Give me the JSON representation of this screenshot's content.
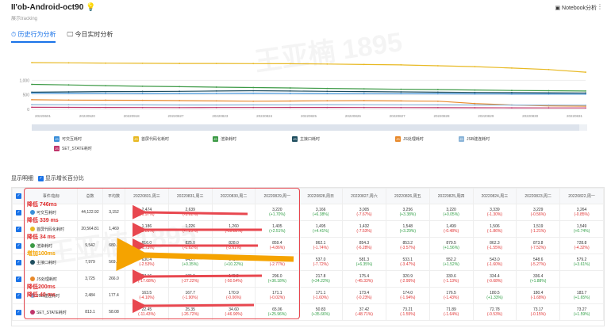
{
  "header": {
    "title": "II'ob-Android-oct90",
    "title_icon": "bulb-icon",
    "subtitle": "展示tracking",
    "notebook_link": "Notebook分析"
  },
  "tabs": [
    {
      "label": "历史行为分析",
      "active": true
    },
    {
      "label": "今日实时分析",
      "active": false
    }
  ],
  "watermarks": [
    "王亚楠 1895",
    "王亚楠 1895"
  ],
  "chart_data": {
    "type": "line",
    "y_ticks": [
      "1,000",
      "500",
      "0"
    ],
    "x": [
      "20220601",
      "20220605",
      "20220609",
      "20220613",
      "20220617",
      "20220621",
      "20220625",
      "20220629",
      "20220703",
      "20220707",
      "20220711",
      "20220715",
      "20220719",
      "20220723",
      "20220727",
      "20220731"
    ],
    "x_tick_labels": [
      "20220601",
      "20220520",
      "20220918",
      "20220827",
      "20220823",
      "20220824",
      "20220825",
      "20220826",
      "20220827",
      "20220828",
      "20220829",
      "20220830",
      "20220831"
    ],
    "series": [
      {
        "name": "首屏代码化耗时",
        "color": "#e8b923",
        "values": [
          1610,
          1600,
          1590,
          1585,
          1580,
          1578,
          1575,
          1570,
          1560,
          1545,
          1530,
          1500,
          1470,
          1420,
          1370,
          1280
        ]
      },
      {
        "name": "渲染耗时",
        "color": "#3d9a46",
        "values": [
          860,
          840,
          815,
          795,
          780,
          765,
          750,
          735,
          720,
          705,
          690,
          680,
          665,
          650,
          640,
          630
        ]
      },
      {
        "name": "主接口耗时",
        "color": "#1f4e5f",
        "values": [
          590,
          600,
          610,
          615,
          620,
          630,
          640,
          630,
          620,
          610,
          600,
          590,
          580,
          575,
          570,
          565
        ]
      },
      {
        "name": "可交互时间",
        "color": "#3a8fd9",
        "values": [
          560,
          555,
          550,
          545,
          548,
          552,
          555,
          550,
          545,
          540,
          538,
          535,
          532,
          530,
          528,
          525
        ]
      },
      {
        "name": "JS处理耗时",
        "color": "#e8892b",
        "values": [
          330,
          320,
          315,
          310,
          300,
          290,
          280,
          285,
          295,
          300,
          290,
          280,
          200,
          150,
          120,
          110
        ]
      },
      {
        "name": "JSB建连耗时",
        "color": "#8ab4d8",
        "values": [
          160,
          158,
          155,
          152,
          150,
          150,
          152,
          155,
          160,
          158,
          155,
          153,
          150,
          148,
          145,
          143
        ]
      },
      {
        "name": "SET_STATE耗时",
        "color": "#c0356b",
        "values": [
          70,
          68,
          65,
          62,
          60,
          62,
          64,
          66,
          65,
          63,
          60,
          58,
          55,
          52,
          50,
          48
        ]
      }
    ],
    "legend": [
      {
        "badge": "JS",
        "name": "可交互耗时",
        "color": "#3a8fd9"
      },
      {
        "badge": "JS",
        "name": "首屏代码化耗时",
        "color": "#e8b923"
      },
      {
        "badge": "JS",
        "name": "渲染耗时",
        "color": "#3d9a46"
      },
      {
        "badge": "JS",
        "name": "主接口耗时",
        "color": "#1f4e5f"
      },
      {
        "badge": "JS",
        "name": "JS处理耗时",
        "color": "#e8892b"
      },
      {
        "badge": "JS",
        "name": "JSB建连耗时",
        "color": "#8ab4d8"
      },
      {
        "badge": "JS",
        "name": "SET_STATE耗时",
        "color": "#c0356b"
      }
    ]
  },
  "section": {
    "label": "显示明细",
    "checkbox_label": "显示增长百分比"
  },
  "table": {
    "headers": [
      "事件/指标",
      "总数",
      "平均数",
      "20220831,周三",
      "20220831,周三",
      "20220830,周二",
      "20220829,周一",
      "20220828,周日",
      "20220827,周六",
      "20220826,周五",
      "20220825,周四",
      "20220824,周三",
      "20220823,周二",
      "20220822,周一"
    ],
    "rows": [
      {
        "name": "可交互耗时",
        "color": "#3a8fd9",
        "total": "44,122.92",
        "avg": "3,152",
        "cells": [
          [
            "2,474",
            "(-6.97%)",
            "up"
          ],
          [
            "2,639",
            "(-3.61%)",
            "up"
          ],
          [
            "",
            "",
            ""
          ],
          [
            "3,220",
            "(+1.70%)",
            "down"
          ],
          [
            "3,166",
            "(+6.38%)",
            "down"
          ],
          [
            "3,005",
            "(-7.67%)",
            "up"
          ],
          [
            "3,256",
            "(+3.38%)",
            "down"
          ],
          [
            "3,220",
            "(+0.05%)",
            "down"
          ],
          [
            "3,339",
            "(-1.30%)",
            "up"
          ],
          [
            "3,229",
            "(-0.56%)",
            "up"
          ],
          [
            "3,264",
            "(-0.85%)",
            "up"
          ]
        ]
      },
      {
        "name": "首屏代码化耗时",
        "color": "#e8b923",
        "total": "20,564.81",
        "avg": "1,469",
        "cells": [
          [
            "1,186",
            "(-5.81%)",
            "up"
          ],
          [
            "1,226",
            "(-7.29%)",
            "up"
          ],
          [
            "1,260",
            "(-10.82%)",
            "up"
          ],
          [
            "1,405",
            "(+2.51%)",
            "down"
          ],
          [
            "1,495",
            "(+4.41%)",
            "down"
          ],
          [
            "1,432",
            "(-7.53%)",
            "up"
          ],
          [
            "1,548",
            "(+3.29%)",
            "down"
          ],
          [
            "1,499",
            "(-0.48%)",
            "up"
          ],
          [
            "1,506",
            "(-1.86%)",
            "up"
          ],
          [
            "1,519",
            "(-1.21%)",
            "up"
          ],
          [
            "1,549",
            "(+0.74%)",
            "down"
          ]
        ]
      },
      {
        "name": "渲染耗时",
        "color": "#3d9a46",
        "total": "9,542",
        "avg": "680.2",
        "cells": [
          [
            "816.0",
            "(-1.73%)",
            "up"
          ],
          [
            "825.0",
            "(-0.62%)",
            "up"
          ],
          [
            "828.0",
            "(-3.61%)",
            "up"
          ],
          [
            "859.4",
            "(-4.86%)",
            "up"
          ],
          [
            "862.1",
            "(-1.74%)",
            "up"
          ],
          [
            "854.3",
            "(-6.28%)",
            "up"
          ],
          [
            "853.2",
            "(-3.57%)",
            "up"
          ],
          [
            "879.5",
            "(+1.56%)",
            "down"
          ],
          [
            "862.3",
            "(-1.55%)",
            "up"
          ],
          [
            "873.8",
            "(-7.52%)",
            "up"
          ],
          [
            "728.8",
            "(-4.32%)",
            "up"
          ]
        ]
      },
      {
        "name": "主接口耗时",
        "color": "#1f4e5f",
        "total": "7,979",
        "avg": "569.9",
        "cells": [
          [
            "630.4",
            "(-2.53%)",
            "up"
          ],
          [
            "645.7",
            "(+0.35%)",
            "down"
          ],
          [
            "643.4",
            "(+10.22%)",
            "down"
          ],
          [
            "522.1",
            "(-2.77%)",
            "up"
          ],
          [
            "537.0",
            "(-7.72%)",
            "up"
          ],
          [
            "581.3",
            "(+6.35%)",
            "down"
          ],
          [
            "533.1",
            "(-3.47%)",
            "up"
          ],
          [
            "552.2",
            "(+1.52%)",
            "down"
          ],
          [
            "543.0",
            "(-1.60%)",
            "up"
          ],
          [
            "548.6",
            "(-5.27%)",
            "up"
          ],
          [
            "579.2",
            "(+3.61%)",
            "down"
          ]
        ]
      },
      {
        "name": "JS处理耗时",
        "color": "#e8892b",
        "total": "3,725",
        "avg": "266.0",
        "cells": [
          [
            "87.16",
            "(-17.68%)",
            "up"
          ],
          [
            "105.9",
            "(-27.22%)",
            "up"
          ],
          [
            "145.5",
            "(-50.54%)",
            "up"
          ],
          [
            "296.0",
            "(+36.18%)",
            "down"
          ],
          [
            "217.8",
            "(+24.22%)",
            "down"
          ],
          [
            "175.4",
            "(-45.33%)",
            "up"
          ],
          [
            "320.9",
            "(-2.95%)",
            "up"
          ],
          [
            "330.6",
            "(-1.13%)",
            "up"
          ],
          [
            "334.4",
            "(-0.68%)",
            "up"
          ],
          [
            "336.4",
            "(+1.88%)",
            "down"
          ],
          [
            "",
            "",
            ""
          ]
        ]
      },
      {
        "name": "JSB建连耗时",
        "color": "#8ab4d8",
        "total": "2,484",
        "avg": "177.4",
        "cells": [
          [
            "163.5",
            "(-4.10%)",
            "up"
          ],
          [
            "167.7",
            "(-1.90%)",
            "up"
          ],
          [
            "170.9",
            "(-0.06%)",
            "up"
          ],
          [
            "171.1",
            "(-0.02%)",
            "up"
          ],
          [
            "171.1",
            "(-1.60%)",
            "up"
          ],
          [
            "173.4",
            "(-0.23%)",
            "up"
          ],
          [
            "174.0",
            "(-1.94%)",
            "up"
          ],
          [
            "176.5",
            "(-1.43%)",
            "up"
          ],
          [
            "180.5",
            "(+1.33%)",
            "down"
          ],
          [
            "180.4",
            "(-1.68%)",
            "up"
          ],
          [
            "183.7",
            "(+1.65%)",
            "down"
          ]
        ]
      },
      {
        "name": "SET_STATE耗时",
        "color": "#c0356b",
        "total": "813.1",
        "avg": "58.08",
        "cells": [
          [
            "22.45",
            "(-11.43%)",
            "up"
          ],
          [
            "25.35",
            "(-26.72%)",
            "up"
          ],
          [
            "34.60",
            "(-46.90%)",
            "up"
          ],
          [
            "65.06",
            "(+25.96%)",
            "down"
          ],
          [
            "50.83",
            "(+35.66%)",
            "down"
          ],
          [
            "37.42",
            "(-48.71%)",
            "up"
          ],
          [
            "73.21",
            "(-1.55%)",
            "up"
          ],
          [
            "71.89",
            "(-1.64%)",
            "up"
          ],
          [
            "72.78",
            "(-0.53%)",
            "up"
          ],
          [
            "73.17",
            "(-0.15%)",
            "up"
          ],
          [
            "73.27",
            "(+1.59%)",
            "down"
          ]
        ]
      }
    ]
  },
  "annotations": [
    {
      "text": "降低 746ms",
      "color": "red"
    },
    {
      "text": "降低 339 ms",
      "color": "red"
    },
    {
      "text": "降低 34 ms",
      "color": "red"
    },
    {
      "text": "增加100ms",
      "color": "yellow"
    },
    {
      "text": "降低200ms",
      "color": "red"
    },
    {
      "text": "降低 40 ms",
      "color": "red"
    }
  ]
}
